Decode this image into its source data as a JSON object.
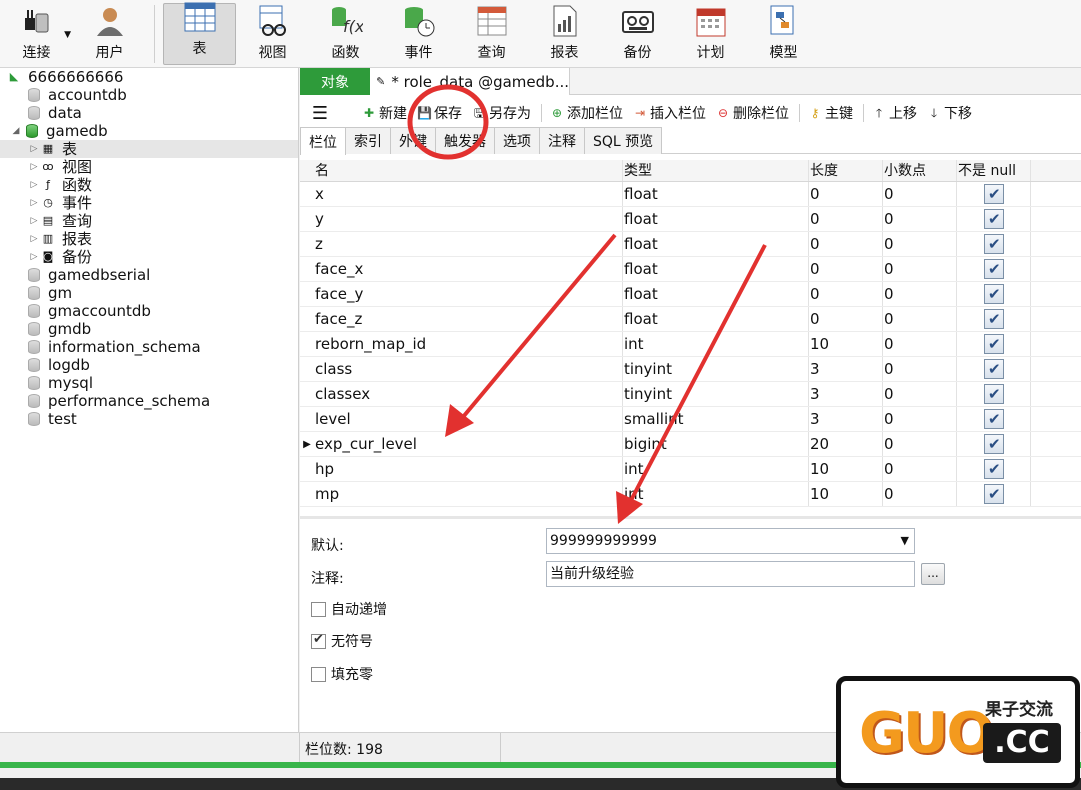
{
  "toolbar": [
    {
      "key": "connect",
      "label": "连接",
      "icon": "connect-plug-icon"
    },
    {
      "key": "user",
      "label": "用户",
      "icon": "user-icon"
    },
    {
      "key": "table",
      "label": "表",
      "icon": "table-icon",
      "active": true
    },
    {
      "key": "view",
      "label": "视图",
      "icon": "view-icon"
    },
    {
      "key": "function",
      "label": "函数",
      "icon": "function-icon"
    },
    {
      "key": "event",
      "label": "事件",
      "icon": "event-icon"
    },
    {
      "key": "query",
      "label": "查询",
      "icon": "query-icon"
    },
    {
      "key": "report",
      "label": "报表",
      "icon": "report-icon"
    },
    {
      "key": "backup",
      "label": "备份",
      "icon": "backup-icon"
    },
    {
      "key": "schedule",
      "label": "计划",
      "icon": "schedule-icon"
    },
    {
      "key": "model",
      "label": "模型",
      "icon": "model-icon"
    }
  ],
  "tree": {
    "connection": "6666666666",
    "databases_before": [
      "accountdb",
      "data"
    ],
    "open_db": "gamedb",
    "open_db_children": [
      {
        "label": "表",
        "icon": "table-icon"
      },
      {
        "label": "视图",
        "icon": "view-icon"
      },
      {
        "label": "函数",
        "icon": "function-icon"
      },
      {
        "label": "事件",
        "icon": "event-icon"
      },
      {
        "label": "查询",
        "icon": "query-icon"
      },
      {
        "label": "报表",
        "icon": "report-icon"
      },
      {
        "label": "备份",
        "icon": "backup-icon"
      }
    ],
    "databases_after": [
      "gamedbserial",
      "gm",
      "gmaccountdb",
      "gmdb",
      "information_schema",
      "logdb",
      "mysql",
      "performance_schema",
      "test"
    ]
  },
  "tabs": {
    "objects_label": "对象",
    "doc_title": "* role_data @gamedb..."
  },
  "actions": {
    "new": "新建",
    "save": "保存",
    "save_as": "另存为",
    "add_field": "添加栏位",
    "insert_field": "插入栏位",
    "delete_field": "删除栏位",
    "primary_key": "主键",
    "move_up": "上移",
    "move_down": "下移"
  },
  "subtabs": [
    "栏位",
    "索引",
    "外键",
    "触发器",
    "选项",
    "注释",
    "SQL 预览"
  ],
  "grid": {
    "headers": [
      "名",
      "类型",
      "长度",
      "小数点",
      "不是 null"
    ],
    "rows": [
      {
        "name": "x",
        "type": "float",
        "length": "0",
        "decimals": "0",
        "not_null": true
      },
      {
        "name": "y",
        "type": "float",
        "length": "0",
        "decimals": "0",
        "not_null": true
      },
      {
        "name": "z",
        "type": "float",
        "length": "0",
        "decimals": "0",
        "not_null": true
      },
      {
        "name": "face_x",
        "type": "float",
        "length": "0",
        "decimals": "0",
        "not_null": true
      },
      {
        "name": "face_y",
        "type": "float",
        "length": "0",
        "decimals": "0",
        "not_null": true
      },
      {
        "name": "face_z",
        "type": "float",
        "length": "0",
        "decimals": "0",
        "not_null": true
      },
      {
        "name": "reborn_map_id",
        "type": "int",
        "length": "10",
        "decimals": "0",
        "not_null": true
      },
      {
        "name": "class",
        "type": "tinyint",
        "length": "3",
        "decimals": "0",
        "not_null": true
      },
      {
        "name": "classex",
        "type": "tinyint",
        "length": "3",
        "decimals": "0",
        "not_null": true
      },
      {
        "name": "level",
        "type": "smallint",
        "length": "3",
        "decimals": "0",
        "not_null": true
      },
      {
        "name": "exp_cur_level",
        "type": "bigint",
        "length": "20",
        "decimals": "0",
        "not_null": true,
        "current": true
      },
      {
        "name": "hp",
        "type": "int",
        "length": "10",
        "decimals": "0",
        "not_null": true
      },
      {
        "name": "mp",
        "type": "int",
        "length": "10",
        "decimals": "0",
        "not_null": true
      }
    ]
  },
  "props": {
    "default_label": "默认:",
    "default_value": "999999999999",
    "comment_label": "注释:",
    "comment_value": "当前升级经验",
    "more_button": "...",
    "auto_increment_label": "自动递增",
    "auto_increment": false,
    "unsigned_label": "无符号",
    "unsigned": true,
    "zerofill_label": "填充零",
    "zerofill": false
  },
  "status": {
    "field_count": "栏位数: 198"
  },
  "watermark": {
    "text_main": "GUO",
    "text_cn": "果子交流",
    "text_domain": ".CC"
  },
  "colors": {
    "accent_green": "#2e9b3a",
    "annotation_red": "#e2312f"
  }
}
